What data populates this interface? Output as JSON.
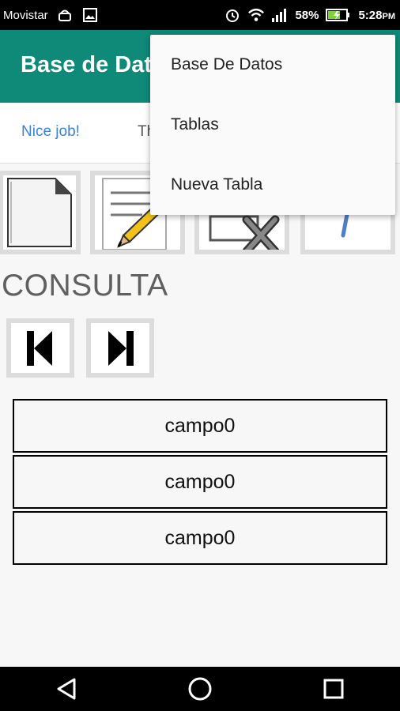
{
  "status_bar": {
    "carrier": "Movistar",
    "battery": "58%",
    "time": "5:28",
    "time_suffix": "PM",
    "icons": [
      "android-icon",
      "image-icon",
      "alarm-icon",
      "wifi-icon",
      "signal-icon",
      "battery-charging-icon"
    ]
  },
  "app_bar": {
    "title": "Base de Datos"
  },
  "ad": {
    "text": "Nice job!",
    "trailing": "Th"
  },
  "toolbar_icons": [
    "document-icon",
    "edit-pencil-icon",
    "delete-icon",
    "pen-icon"
  ],
  "section": {
    "title": "CONSULTA"
  },
  "navigation_buttons": [
    "previous-record-icon",
    "next-record-icon"
  ],
  "fields": [
    "campo0",
    "campo0",
    "campo0"
  ],
  "overflow_menu": {
    "items": [
      "Base De Datos",
      "Tablas",
      "Nueva Tabla"
    ]
  },
  "system_nav": [
    "back-icon",
    "home-icon",
    "recents-icon"
  ]
}
